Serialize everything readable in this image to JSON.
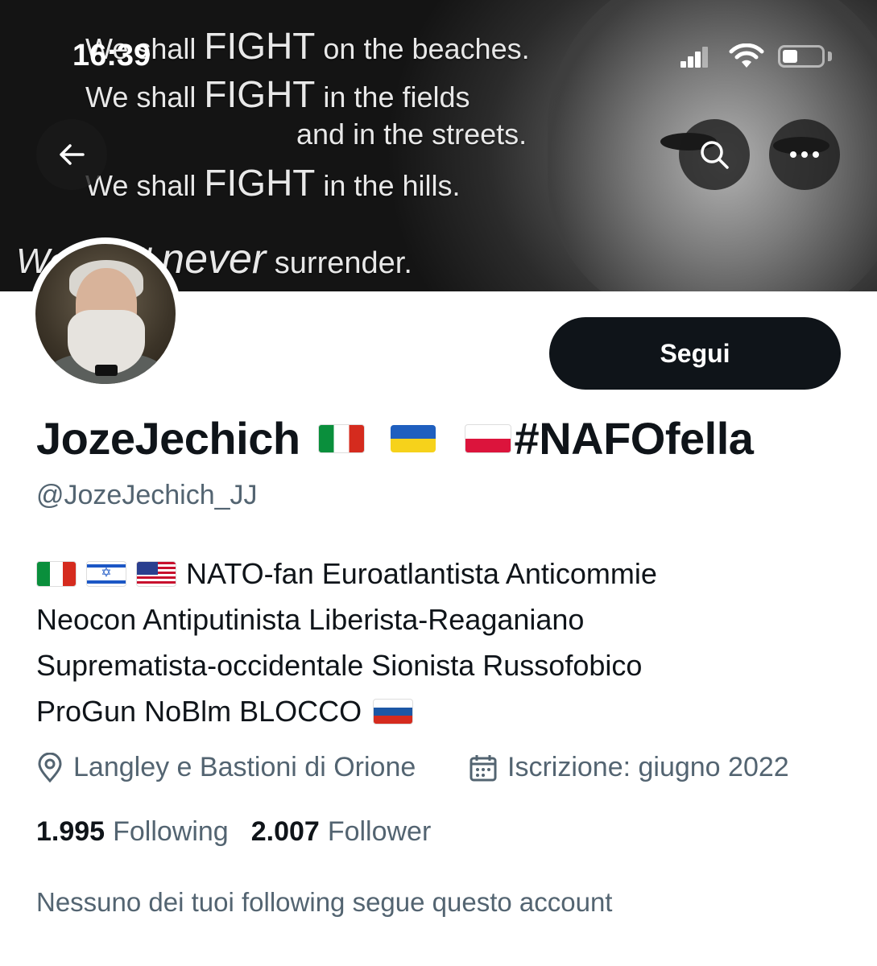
{
  "status_bar": {
    "time": "16:39"
  },
  "banner": {
    "quote_line1_a": "We shall ",
    "quote_line1_b": "FIGHT",
    "quote_line1_c": " on the beaches.",
    "quote_line2_a": "We shall ",
    "quote_line2_b": "FIGHT",
    "quote_line2_c": " in the fields",
    "quote_line3": "and in the streets.",
    "quote_line4_a": "We shall ",
    "quote_line4_b": "FIGHT",
    "quote_line4_c": " in the hills.",
    "quote_line5_a": "We shall ",
    "quote_line5_b": "never",
    "quote_line5_c": " surrender."
  },
  "profile": {
    "follow_label": "Segui",
    "display_name": "JozeJechich",
    "display_name_suffix": "#NAFOfella",
    "handle": "@JozeJechich_JJ",
    "bio_lines": [
      "NATO-fan Euroatlantista Anticommie",
      "Neocon Antiputinista Liberista-Reaganiano",
      "Suprematista-occidentale Sionista Russofobico",
      "ProGun NoBlm BLOCCO"
    ],
    "location": "Langley e Bastioni di Orione",
    "joined": "Iscrizione: giugno 2022",
    "following_count": "1.995",
    "following_label": "Following",
    "followers_count": "2.007",
    "followers_label": "Follower",
    "mutuals_text": "Nessuno dei tuoi following segue questo account"
  },
  "icons": [
    "back-arrow-icon",
    "search-icon",
    "more-icon",
    "location-pin-icon",
    "calendar-icon",
    "signal-icon",
    "wifi-icon",
    "battery-icon"
  ],
  "colors": {
    "follow_bg": "#0f1419",
    "secondary_text": "#536471"
  }
}
